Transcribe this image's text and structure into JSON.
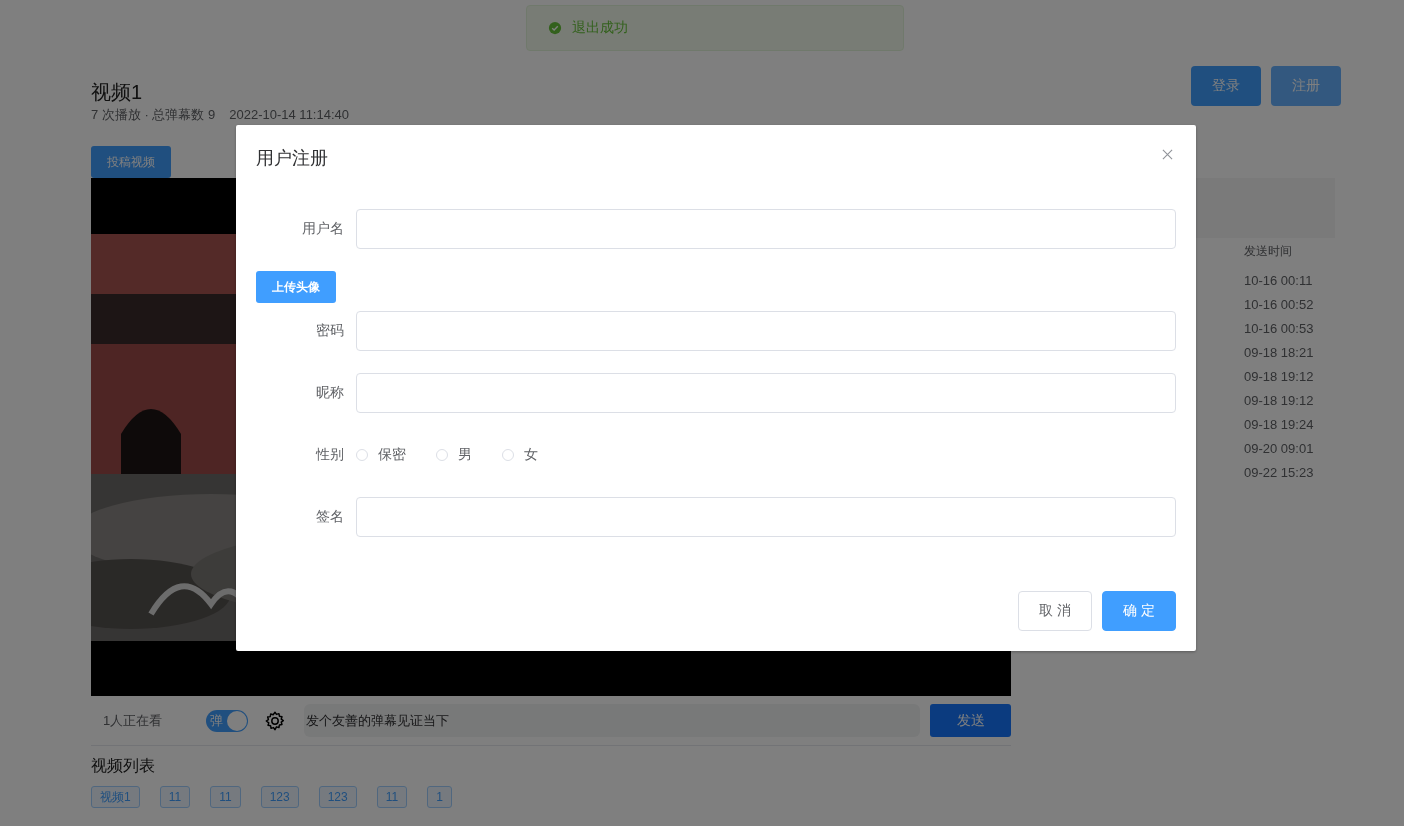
{
  "toast": {
    "kind": "success",
    "message": "退出成功"
  },
  "video": {
    "title": "视频1",
    "meta": "7 次播放 · 总弹幕数 9",
    "date": "2022-10-14 11:14:40",
    "upload_button": "投稿视频",
    "viewers": "1人正在看",
    "danmaku_switch": {
      "label": "弹",
      "on": true
    },
    "danmaku_input": {
      "placeholder": "发个友善的弹幕见证当下"
    },
    "send_button": "发送"
  },
  "auth_buttons": [
    "登录",
    "注册"
  ],
  "video_list": {
    "title": "视频列表",
    "items": [
      "视频1",
      "11",
      "11",
      "123",
      "123",
      "11",
      "1"
    ]
  },
  "danmaku_table": {
    "columns": [
      "发送时间"
    ],
    "rows": [
      "10-16 00:11",
      "10-16 00:52",
      "10-16 00:53",
      "09-18 18:21",
      "09-18 19:12",
      "09-18 19:12",
      "09-18 19:24",
      "09-20 09:01",
      "09-22 15:23"
    ]
  },
  "dialog": {
    "title": "用户注册",
    "fields": [
      {
        "kind": "text",
        "label": "用户名"
      },
      {
        "kind": "upload",
        "button": "上传头像"
      },
      {
        "kind": "text",
        "label": "密码"
      },
      {
        "kind": "text",
        "label": "昵称"
      },
      {
        "kind": "radio",
        "label": "性别",
        "options": [
          {
            "label": "保密",
            "selected": false
          },
          {
            "label": "男",
            "selected": false
          },
          {
            "label": "女",
            "selected": false
          }
        ]
      },
      {
        "kind": "text",
        "label": "签名"
      }
    ],
    "buttons": [
      {
        "kind": "cancel",
        "label": "取 消"
      },
      {
        "kind": "confirm",
        "label": "确 定"
      }
    ]
  }
}
